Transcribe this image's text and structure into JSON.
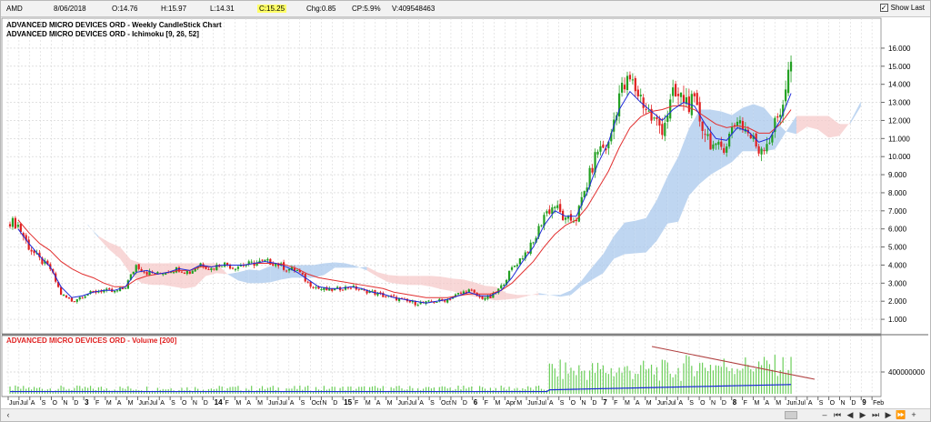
{
  "toolbar": {
    "symbol": "AMD",
    "date": "8/06/2018",
    "open": "O:14.76",
    "high": "H:15.97",
    "low": "L:14.31",
    "close": "C:15.25",
    "change": "Chg:0.85",
    "change_pct": "CP:5.9%",
    "volume": "V:409548463",
    "show_last_label": "Show Last",
    "show_last_checked": true
  },
  "price_panel": {
    "title_line1": "ADVANCED MICRO DEVICES ORD - Weekly CandleStick Chart",
    "title_line2": "ADVANCED MICRO DEVICES ORD - Ichimoku [9, 26, 52]",
    "y_ticks": [
      "16.000",
      "15.000",
      "14.000",
      "13.000",
      "12.000",
      "11.000",
      "10.000",
      "9.000",
      "8.000",
      "7.000",
      "6.000",
      "5.000",
      "4.000",
      "3.000",
      "2.000",
      "1.000"
    ]
  },
  "volume_panel": {
    "title": "ADVANCED MICRO DEVICES ORD - Volume [200]",
    "y_tick": "400000000"
  },
  "x_axis_labels": [
    "Jun",
    "Jul",
    "A",
    "S",
    "O",
    "N",
    "D",
    "3",
    "F",
    "M",
    "A",
    "M",
    "Jun",
    "Jul",
    "A",
    "S",
    "O",
    "N",
    "D",
    "14",
    "F",
    "M",
    "A",
    "M",
    "Jun",
    "Jul",
    "A",
    "S",
    "Oct",
    "N",
    "D",
    "15",
    "F",
    "M",
    "A",
    "M",
    "Jun",
    "Jul",
    "A",
    "S",
    "Oct",
    "N",
    "D",
    "6",
    "F",
    "M",
    "Apr",
    "M",
    "Jun",
    "Jul",
    "A",
    "S",
    "O",
    "N",
    "D",
    "7",
    "F",
    "M",
    "A",
    "M",
    "Jun",
    "Jul",
    "A",
    "S",
    "O",
    "N",
    "D",
    "8",
    "F",
    "M",
    "A",
    "M",
    "Jun",
    "Jul",
    "A",
    "S",
    "O",
    "N",
    "D",
    "9",
    "Feb"
  ],
  "colors": {
    "bull": "#22a022",
    "bear": "#e02020",
    "tenkan": "#1e2ad8",
    "kijun": "#e23030",
    "cloud_bull": "#a9c8ec",
    "cloud_bear": "#f6c9c9",
    "volume_bar": "#6ccf5a",
    "volume_ma": "#1e2ad8",
    "trendline": "#b04040"
  },
  "chart_data": {
    "type": "candlestick",
    "symbol": "AMD",
    "interval": "weekly",
    "ylim": [
      0.4,
      16.5
    ],
    "x": [
      "Jun 2012",
      "Jul 2012",
      "Aug 2012",
      "Sep 2012",
      "Oct 2012",
      "Nov 2012",
      "Dec 2012",
      "Jan 2013",
      "Feb 2013",
      "Mar 2013",
      "Apr 2013",
      "May 2013",
      "Jun 2013",
      "Jul 2013",
      "Aug 2013",
      "Sep 2013",
      "Oct 2013",
      "Nov 2013",
      "Dec 2013",
      "Jan 2014",
      "Feb 2014",
      "Mar 2014",
      "Apr 2014",
      "May 2014",
      "Jun 2014",
      "Jul 2014",
      "Aug 2014",
      "Sep 2014",
      "Oct 2014",
      "Nov 2014",
      "Dec 2014",
      "Jan 2015",
      "Feb 2015",
      "Mar 2015",
      "Apr 2015",
      "May 2015",
      "Jun 2015",
      "Jul 2015",
      "Aug 2015",
      "Sep 2015",
      "Oct 2015",
      "Nov 2015",
      "Dec 2015",
      "Jan 2016",
      "Feb 2016",
      "Mar 2016",
      "Apr 2016",
      "May 2016",
      "Jun 2016",
      "Jul 2016",
      "Aug 2016",
      "Sep 2016",
      "Oct 2016",
      "Nov 2016",
      "Dec 2016",
      "Jan 2017",
      "Feb 2017",
      "Mar 2017",
      "Apr 2017",
      "May 2017",
      "Jun 2017",
      "Jul 2017",
      "Aug 2017",
      "Sep 2017",
      "Oct 2017",
      "Nov 2017",
      "Dec 2017",
      "Jan 2018",
      "Feb 2018",
      "Mar 2018",
      "Apr 2018",
      "May 2018",
      "Jun 2018"
    ],
    "close": [
      6.2,
      5.0,
      4.3,
      3.8,
      2.4,
      2.0,
      2.3,
      2.5,
      2.6,
      2.5,
      2.8,
      4.0,
      3.6,
      3.5,
      3.7,
      3.8,
      3.6,
      4.1,
      3.8,
      4.1,
      3.9,
      4.0,
      4.1,
      4.2,
      4.1,
      3.8,
      3.7,
      3.0,
      2.7,
      2.6,
      2.7,
      2.8,
      2.6,
      2.5,
      2.3,
      2.2,
      2.0,
      1.9,
      1.9,
      2.0,
      2.1,
      2.4,
      2.6,
      2.2,
      2.2,
      2.8,
      3.8,
      4.5,
      5.2,
      6.8,
      7.3,
      6.4,
      6.6,
      8.5,
      10.4,
      10.6,
      13.5,
      14.2,
      13.3,
      12.1,
      11.6,
      13.3,
      13.2,
      12.8,
      11.4,
      10.3,
      10.8,
      12.2,
      11.3,
      10.4,
      11.0,
      12.5,
      15.25
    ],
    "tenkan_sen": [
      6.0,
      5.2,
      4.5,
      3.9,
      2.8,
      2.2,
      2.3,
      2.5,
      2.6,
      2.6,
      2.8,
      3.6,
      3.7,
      3.5,
      3.6,
      3.8,
      3.7,
      4.0,
      3.9,
      4.0,
      4.0,
      4.0,
      4.1,
      4.2,
      4.1,
      3.9,
      3.6,
      3.2,
      2.8,
      2.7,
      2.7,
      2.8,
      2.7,
      2.5,
      2.4,
      2.2,
      2.1,
      2.0,
      1.9,
      2.0,
      2.1,
      2.3,
      2.5,
      2.3,
      2.3,
      2.6,
      3.3,
      4.2,
      5.0,
      6.2,
      7.0,
      6.7,
      6.7,
      8.0,
      9.6,
      10.8,
      12.6,
      13.6,
      13.0,
      12.5,
      12.0,
      12.6,
      13.0,
      12.8,
      11.8,
      11.0,
      10.9,
      11.6,
      11.4,
      10.8,
      11.0,
      12.0,
      13.5
    ],
    "kijun_sen": [
      6.5,
      5.8,
      5.2,
      4.8,
      4.2,
      3.8,
      3.5,
      3.3,
      3.0,
      2.8,
      2.8,
      3.2,
      3.4,
      3.5,
      3.6,
      3.7,
      3.7,
      3.9,
      3.9,
      4.0,
      4.0,
      4.0,
      4.1,
      4.1,
      4.1,
      4.0,
      3.8,
      3.5,
      3.3,
      3.2,
      3.1,
      3.0,
      2.9,
      2.8,
      2.7,
      2.5,
      2.4,
      2.3,
      2.2,
      2.2,
      2.2,
      2.3,
      2.4,
      2.4,
      2.4,
      2.6,
      3.0,
      3.6,
      4.2,
      5.0,
      5.7,
      6.2,
      6.5,
      7.2,
      8.2,
      9.2,
      10.5,
      11.6,
      12.2,
      12.5,
      12.6,
      12.8,
      12.8,
      12.6,
      12.2,
      11.8,
      11.6,
      11.7,
      11.6,
      11.3,
      11.3,
      11.8,
      12.6
    ],
    "volume_last": 409548463
  }
}
